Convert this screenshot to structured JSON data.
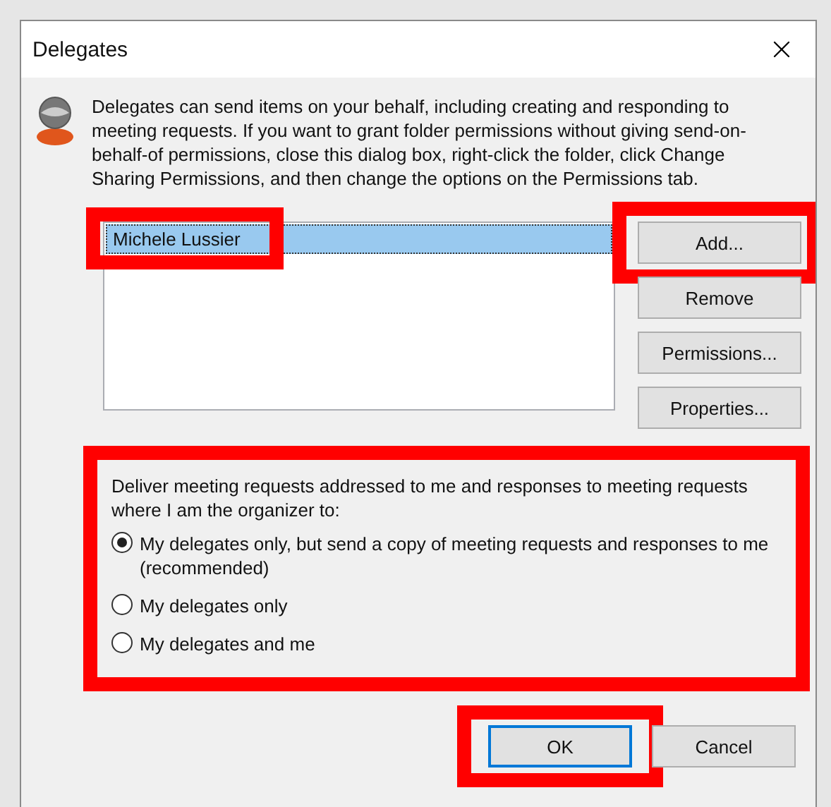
{
  "window": {
    "title": "Delegates"
  },
  "description": "Delegates can send items on your behalf, including creating and responding to meeting requests. If you want to grant folder permissions without giving send-on-behalf-of permissions, close this dialog box, right-click the folder, click Change Sharing Permissions, and then change the options on the Permissions tab.",
  "delegates": [
    {
      "name": "Michele Lussier",
      "selected": true,
      "highlighted": true
    }
  ],
  "buttons": [
    {
      "label": "Add...",
      "highlighted": true
    },
    {
      "label": "Remove",
      "highlighted": false
    },
    {
      "label": "Permissions...",
      "highlighted": false
    },
    {
      "label": "Properties...",
      "highlighted": false
    }
  ],
  "delivery": {
    "prompt": "Deliver meeting requests addressed to me and responses to meeting requests where I am the organizer to:",
    "highlighted": true,
    "options": [
      {
        "label": "My delegates only, but send a copy of meeting requests and responses to me (recommended)",
        "selected": true
      },
      {
        "label": "My delegates only",
        "selected": false
      },
      {
        "label": "My delegates and me",
        "selected": false
      }
    ]
  },
  "footer_buttons": [
    {
      "label": "OK",
      "default": true,
      "highlighted": true
    },
    {
      "label": "Cancel",
      "default": false,
      "highlighted": false
    }
  ]
}
